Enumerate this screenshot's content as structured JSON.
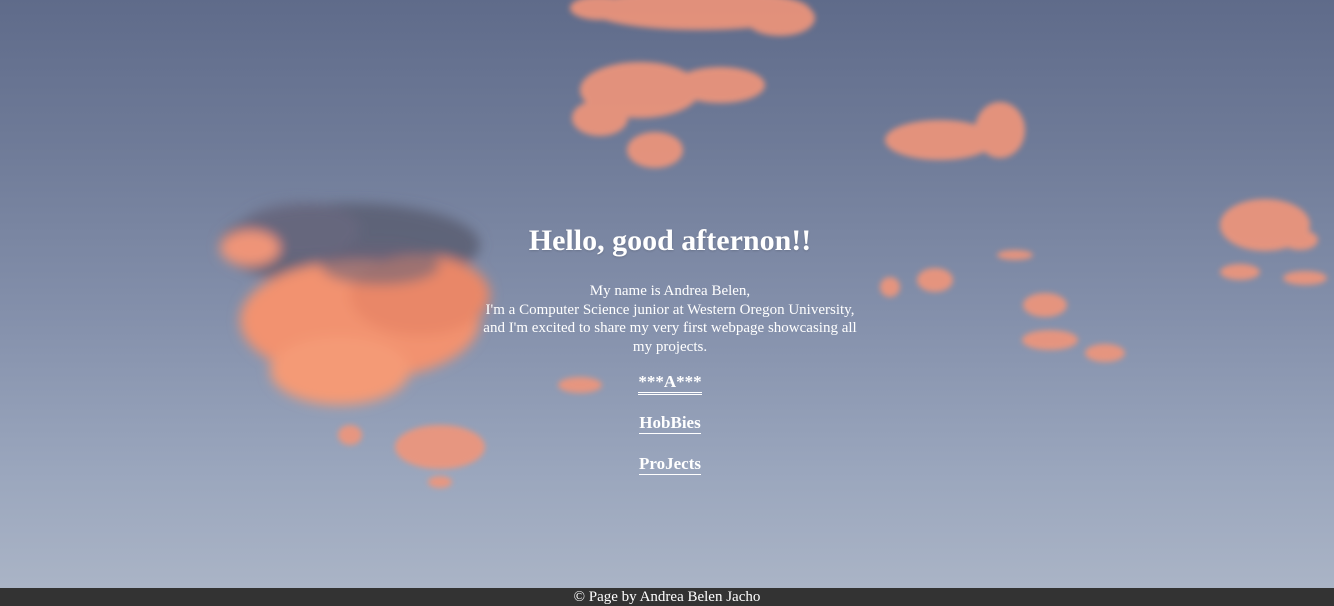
{
  "header": {
    "title": "Hello, good afternon!!"
  },
  "intro": {
    "line1": "My name is Andrea Belen,",
    "line2": "I'm a Computer Science junior at Western Oregon University,",
    "line3": "and I'm excited to share my very first webpage showcasing all",
    "line4": "my projects."
  },
  "nav": {
    "links": [
      {
        "label": "***A***"
      },
      {
        "label": "HobBies"
      },
      {
        "label": "ProJects"
      }
    ]
  },
  "footer": {
    "text": "© Page by Andrea Belen Jacho"
  },
  "colors": {
    "text": "#ffffff",
    "footer_bg": "#333333",
    "sky_top": "#5f6b8a",
    "sky_bottom": "#aab4c6",
    "cloud": "#f59a78"
  }
}
